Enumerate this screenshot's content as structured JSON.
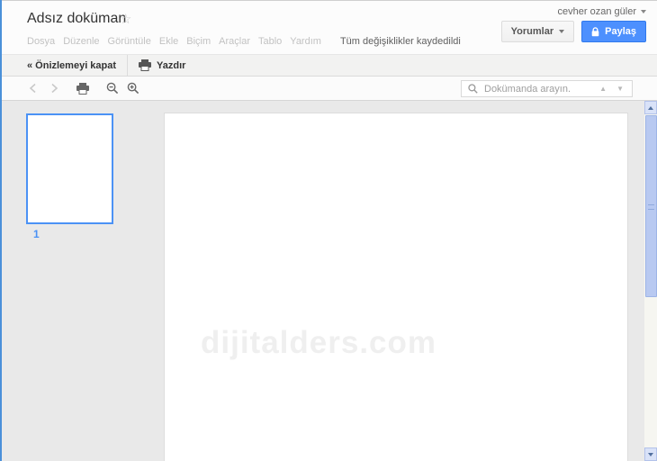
{
  "header": {
    "title": "Adsız doküman",
    "account_name": "cevher ozan güler",
    "menus": [
      "Dosya",
      "Düzenle",
      "Görüntüle",
      "Ekle",
      "Biçim",
      "Araçlar",
      "Tablo",
      "Yardım"
    ],
    "save_status": "Tüm değişiklikler kaydedildi",
    "comments_button": "Yorumlar",
    "share_button": "Paylaş"
  },
  "preview_bar": {
    "close_preview_label": "« Önizlemeyi kapat",
    "print_label": "Yazdır"
  },
  "print_toolbar": {
    "search_placeholder": "Dokümanda arayın."
  },
  "thumbnails": {
    "page_number": "1"
  },
  "document": {
    "watermark": "dijitalders.com"
  },
  "icons": {
    "star": "☆",
    "search_prev": "▲",
    "search_next": "▼"
  },
  "colors": {
    "share_button": "#4d90fe",
    "selected_thumbnail_border": "#4b92f5",
    "page_number": "#4b92f5",
    "scrollbar_thumb": "#b8c9f1",
    "content_background": "#e9e9e9"
  }
}
